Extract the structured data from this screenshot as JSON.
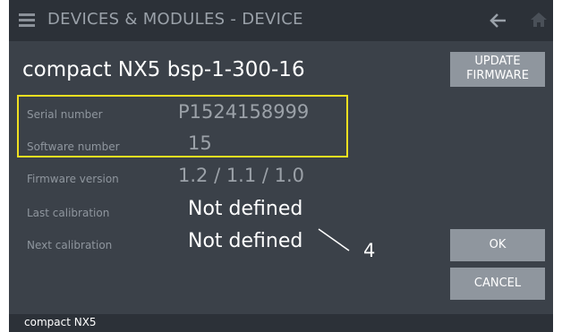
{
  "header": {
    "title": "DEVICES & MODULES - DEVICE",
    "menu_icon": "menu-icon",
    "back_icon": "back-arrow-icon",
    "home_icon": "home-icon"
  },
  "device": {
    "name": "compact NX5 bsp-1-300-16"
  },
  "buttons": {
    "update_firmware_line1": "UPDATE",
    "update_firmware_line2": "FIRMWARE",
    "ok": "OK",
    "cancel": "CANCEL"
  },
  "fields": [
    {
      "label": "Serial number",
      "value": "P1524158999"
    },
    {
      "label": "Software number",
      "value": "15"
    },
    {
      "label": "Firmware version",
      "value": "1.2 / 1.1 / 1.0"
    },
    {
      "label": "Last calibration",
      "value": "Not defined"
    },
    {
      "label": "Next calibration",
      "value": "Not defined"
    }
  ],
  "annotation": {
    "callout_number": "4",
    "highlight_color": "#f0e020"
  },
  "footer": {
    "text": "compact NX5"
  },
  "colors": {
    "background": "#3b4149",
    "header": "#2c3138",
    "button": "#8f969e",
    "label": "#8f969e"
  }
}
